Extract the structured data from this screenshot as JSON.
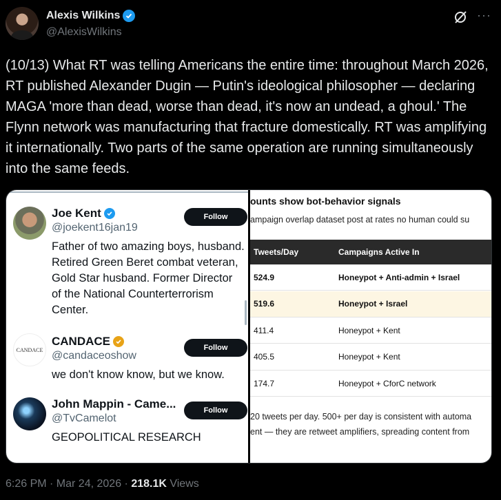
{
  "author": {
    "name": "Alexis Wilkins",
    "handle": "@AlexisWilkins"
  },
  "tweet": {
    "text": "(10/13) What RT was telling Americans the entire time: throughout March 2026, RT published Alexander Dugin — Putin's ideological philosopher — declaring MAGA 'more than dead, worse than dead, it's now an undead, a ghoul.' The Flynn network was manufacturing that fracture domestically. RT was amplifying it internationally. Two parts of the same operation are running simultaneously into the same feeds.",
    "time": "6:26 PM · Mar 24, 2026 · ",
    "views_count": "218.1K",
    "views_label": " Views"
  },
  "icons": {
    "more": "more-icon",
    "grok": "grok-icon",
    "verified": "verified-badge-icon"
  },
  "colors": {
    "accent": "#1d9bf0",
    "gold_badge": "#e8a317",
    "highlight_row": "#fdf6e3",
    "table_header": "#2a2a2a"
  },
  "left_panel": {
    "accounts": [
      {
        "name": "Joe Kent",
        "handle": "@joekent16jan19",
        "badge": "blue",
        "bio": "Father of two amazing boys, husband. Retired Green Beret combat veteran, Gold Star husband. Former Director of the National Counterterrorism Center.",
        "follow": "Follow"
      },
      {
        "name": "CANDACE",
        "handle": "@candaceoshow",
        "badge": "gold",
        "avatar_text": "CANDACE",
        "bio": "we don't know know, but we know.",
        "follow": "Follow"
      },
      {
        "name": "John Mappin - Came...",
        "handle": "@TvCamelot",
        "badge": "none",
        "bio": "GEOPOLITICAL RESEARCH",
        "follow": "Follow"
      }
    ]
  },
  "right_panel": {
    "title": "ounts show bot-behavior signals",
    "subtitle": "ampaign overlap dataset post at rates no human could su",
    "headers": [
      "Tweets/Day",
      "Campaigns Active In"
    ],
    "rows": [
      {
        "tweets": "524.9",
        "campaigns": "Honeypot + Anti-admin + Israel",
        "bold": true,
        "highlight": false
      },
      {
        "tweets": "519.6",
        "campaigns": "Honeypot + Israel",
        "bold": true,
        "highlight": true
      },
      {
        "tweets": "411.4",
        "campaigns": "Honeypot + Kent",
        "bold": false,
        "highlight": false
      },
      {
        "tweets": "405.5",
        "campaigns": "Honeypot + Kent",
        "bold": false,
        "highlight": false
      },
      {
        "tweets": "174.7",
        "campaigns": "Honeypot + CforC network",
        "bold": false,
        "highlight": false
      }
    ],
    "footer": [
      "20 tweets per day. 500+ per day is consistent with automa",
      "ent — they are retweet amplifiers, spreading content from"
    ]
  }
}
